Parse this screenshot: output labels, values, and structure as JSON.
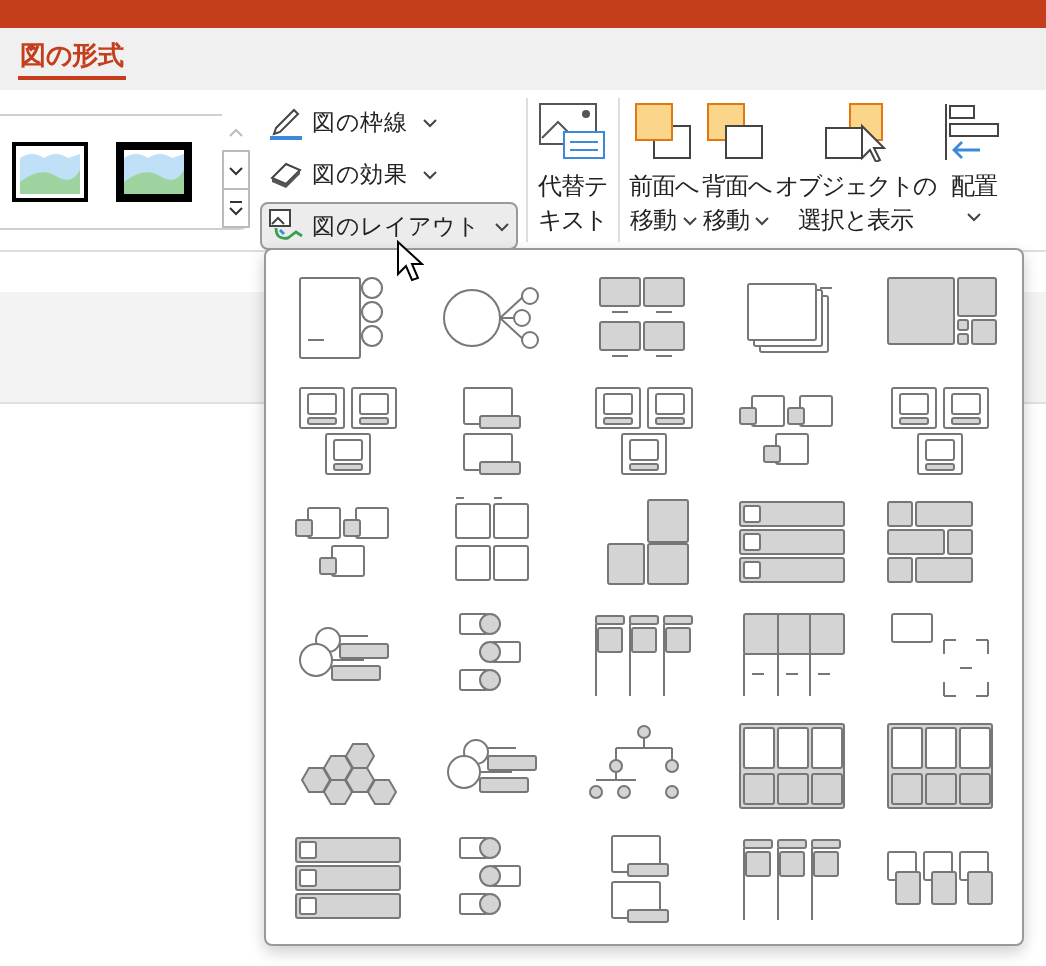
{
  "tabs": [
    {
      "label": "図の形式",
      "selected": true
    }
  ],
  "style_gallery": {
    "scroll_up_disabled": true
  },
  "picture_commands": [
    {
      "label": "図の枠線",
      "kind": "border",
      "selected": false
    },
    {
      "label": "図の効果",
      "kind": "effects",
      "selected": false
    },
    {
      "label": "図のレイアウト",
      "kind": "layout",
      "selected": true
    }
  ],
  "alt_text": {
    "lines": [
      "代替テ",
      "キスト"
    ]
  },
  "arrange": [
    {
      "lines": [
        "前面へ",
        "移動"
      ],
      "kind": "bring-forward",
      "dropdown": true
    },
    {
      "lines": [
        "背面へ",
        "移動"
      ],
      "kind": "send-backward",
      "dropdown": true
    },
    {
      "lines": [
        "オブジェクトの",
        "選択と表示"
      ],
      "kind": "selection-pane",
      "dropdown": false
    },
    {
      "lines": [
        "配置"
      ],
      "kind": "align",
      "dropdown": true
    }
  ],
  "layout_gallery": {
    "items": [
      {
        "kind": "accent-circles"
      },
      {
        "kind": "hub"
      },
      {
        "kind": "tiles"
      },
      {
        "kind": "stack"
      },
      {
        "kind": "mosaic"
      },
      {
        "kind": "frames"
      },
      {
        "kind": "captioned"
      },
      {
        "kind": "frames"
      },
      {
        "kind": "offset"
      },
      {
        "kind": "frames"
      },
      {
        "kind": "offset"
      },
      {
        "kind": "cards"
      },
      {
        "kind": "blocks"
      },
      {
        "kind": "bars"
      },
      {
        "kind": "bricks"
      },
      {
        "kind": "bubbles"
      },
      {
        "kind": "timeline"
      },
      {
        "kind": "columns"
      },
      {
        "kind": "table"
      },
      {
        "kind": "corners"
      },
      {
        "kind": "hexagons"
      },
      {
        "kind": "bubbles"
      },
      {
        "kind": "tree"
      },
      {
        "kind": "panels"
      },
      {
        "kind": "panels"
      },
      {
        "kind": "bars"
      },
      {
        "kind": "timeline"
      },
      {
        "kind": "captioned"
      },
      {
        "kind": "columns"
      },
      {
        "kind": "steps"
      }
    ]
  }
}
